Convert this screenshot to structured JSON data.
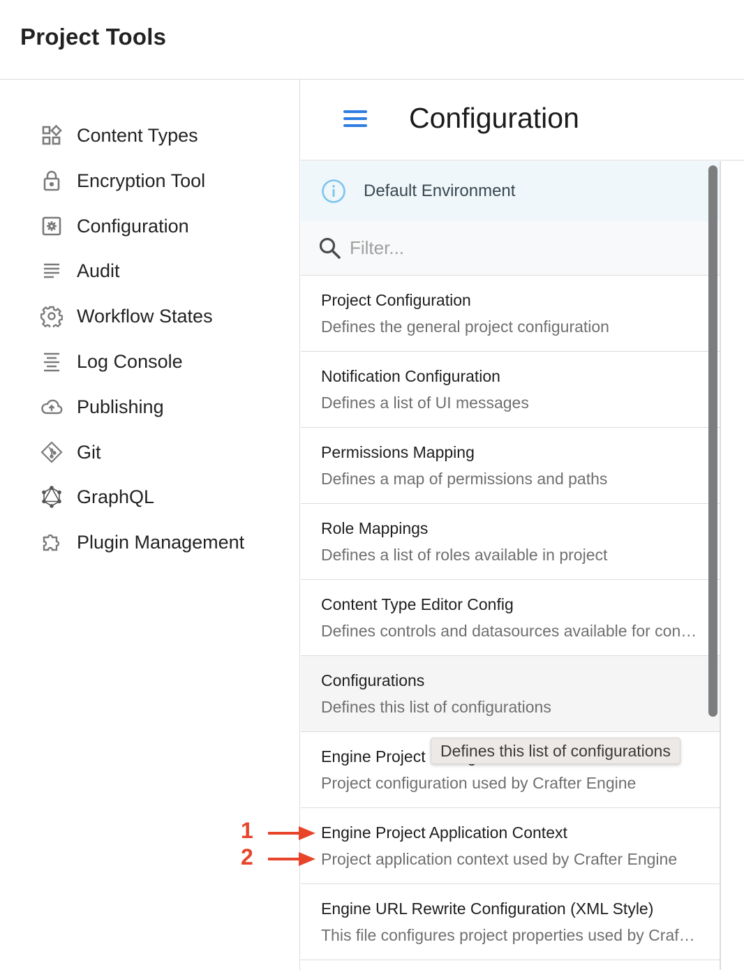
{
  "app": {
    "title": "Project Tools"
  },
  "sidebar": {
    "items": [
      {
        "label": "Content Types",
        "icon": "content-types-icon"
      },
      {
        "label": "Encryption Tool",
        "icon": "lock-icon"
      },
      {
        "label": "Configuration",
        "icon": "settings-box-icon"
      },
      {
        "label": "Audit",
        "icon": "list-lines-icon"
      },
      {
        "label": "Workflow States",
        "icon": "gear-icon"
      },
      {
        "label": "Log Console",
        "icon": "align-center-icon"
      },
      {
        "label": "Publishing",
        "icon": "cloud-upload-icon"
      },
      {
        "label": "Git",
        "icon": "git-icon"
      },
      {
        "label": "GraphQL",
        "icon": "graphql-icon"
      },
      {
        "label": "Plugin Management",
        "icon": "puzzle-icon"
      }
    ]
  },
  "main": {
    "title": "Configuration",
    "menu_icon": "hamburger-menu-icon",
    "environment": {
      "label": "Default Environment",
      "icon": "info-icon"
    },
    "filter": {
      "placeholder": "Filter...",
      "value": ""
    },
    "items": [
      {
        "title": "Project Configuration",
        "description": "Defines the general project configuration"
      },
      {
        "title": "Notification Configuration",
        "description": "Defines a list of UI messages"
      },
      {
        "title": "Permissions Mapping",
        "description": "Defines a map of permissions and paths"
      },
      {
        "title": "Role Mappings",
        "description": "Defines a list of roles available in project"
      },
      {
        "title": "Content Type Editor Config",
        "description": "Defines controls and datasources available for content types"
      },
      {
        "title": "Configurations",
        "description": "Defines this list of configurations"
      },
      {
        "title": "Engine Project Configuration",
        "description": "Project configuration used by Crafter Engine"
      },
      {
        "title": "Engine Project Application Context",
        "description": "Project application context used by Crafter Engine"
      },
      {
        "title": "Engine URL Rewrite Configuration (XML Style)",
        "description": "This file configures project properties used by Crafter Engine"
      }
    ],
    "hovered_index": 5,
    "tooltip": "Defines this list of configurations"
  },
  "annotations": [
    {
      "number": "1",
      "target": "Engine Project Application Context title"
    },
    {
      "number": "2",
      "target": "Engine Project Application Context description"
    }
  ],
  "colors": {
    "accent": "#2f7de1",
    "info": "#7cc4ee",
    "annotation": "#e8442a",
    "banner_bg": "#eff7fa"
  }
}
